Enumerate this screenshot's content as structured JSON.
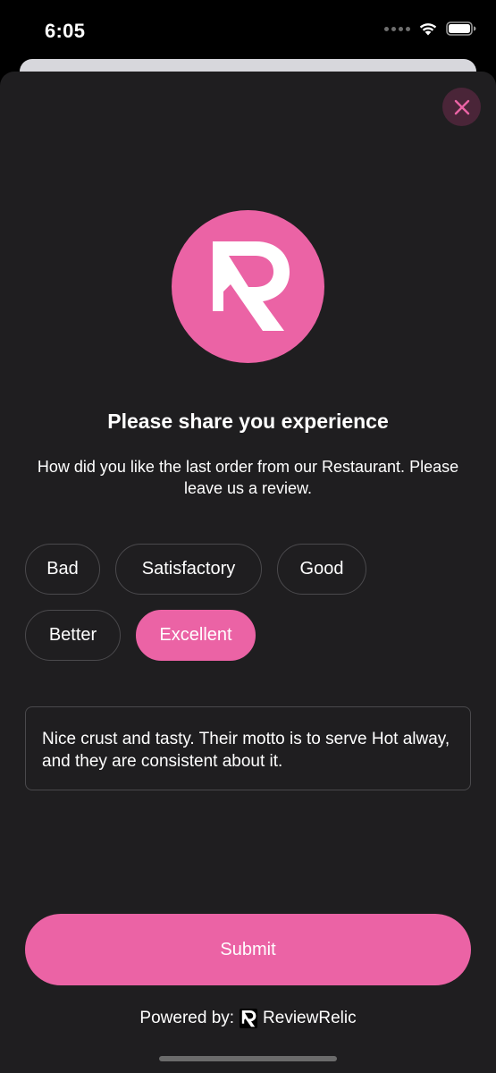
{
  "status_bar": {
    "time": "6:05"
  },
  "dialog": {
    "title": "Please share you experience",
    "subtitle": "How did you like the last order from our Restaurant. Please leave us a review.",
    "ratings": [
      {
        "label": "Bad",
        "selected": false
      },
      {
        "label": "Satisfactory",
        "selected": false
      },
      {
        "label": "Good",
        "selected": false
      },
      {
        "label": "Better",
        "selected": false
      },
      {
        "label": "Excellent",
        "selected": true
      }
    ],
    "review_text": "Nice crust and tasty. Their motto is to serve Hot alway, and they are consistent about it.",
    "submit_label": "Submit",
    "powered_by_label": "Powered by:",
    "brand_name": "ReviewRelic"
  },
  "colors": {
    "accent": "#eb63a5",
    "sheet_background": "#1f1e20",
    "close_button_background": "#4a2538",
    "chip_border": "#4a494c"
  },
  "icons": {
    "close": "close-icon",
    "logo": "reviewrelic-logo-icon",
    "brand_small": "reviewrelic-small-logo-icon",
    "wifi": "wifi-icon",
    "battery": "battery-icon",
    "signal": "signal-icon"
  }
}
